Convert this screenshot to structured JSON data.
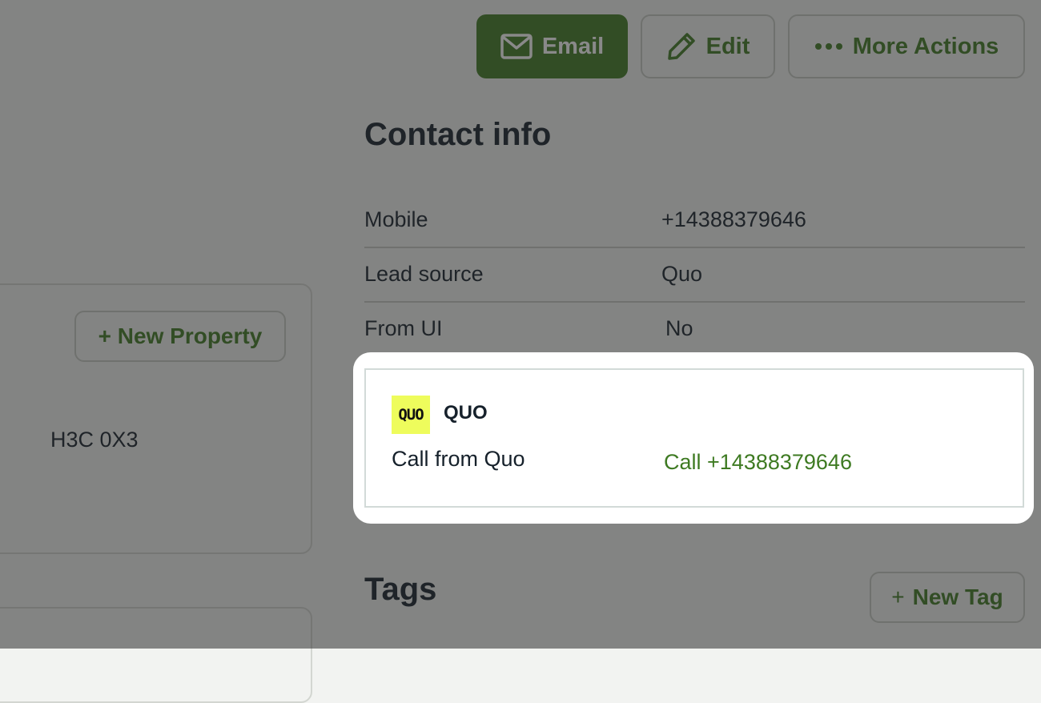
{
  "header": {
    "email_label": "Email",
    "edit_label": "Edit",
    "more_label": "More Actions",
    "icons": {
      "email": "envelope-icon",
      "edit": "pencil-icon",
      "more": "ellipsis-icon"
    }
  },
  "contact_info": {
    "title": "Contact info",
    "rows": [
      {
        "label": "Mobile",
        "value": "+14388379646"
      },
      {
        "label": "Lead source",
        "value": "Quo"
      },
      {
        "label": "From UI",
        "value": "No"
      }
    ]
  },
  "property_panel": {
    "new_property_label": "+ New Property",
    "postal_code": "H3C 0X3"
  },
  "integration_card": {
    "logo_text": "QUO",
    "brand_name": "QUO",
    "description": "Call from Quo",
    "action_label": "Call +14388379646"
  },
  "tags": {
    "title": "Tags",
    "new_tag_label": "New Tag",
    "new_tag_plus": "+"
  },
  "colors": {
    "accent": "#3e7a22",
    "background": "#f2f3f1",
    "text": "#16212b",
    "quo_logo": "#eefc5c"
  }
}
